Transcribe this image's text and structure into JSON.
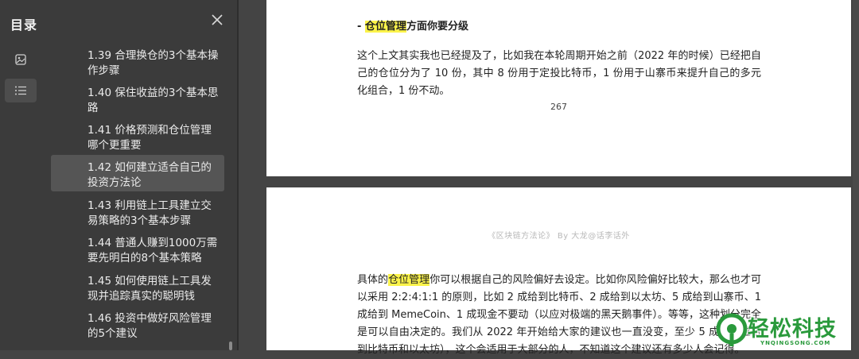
{
  "sidebar": {
    "title": "目录",
    "rail": {
      "thumbnail_icon": "image-icon",
      "outline_icon": "list-icon"
    },
    "toc": [
      {
        "label": "1.39 合理换仓的3个基本操作步骤",
        "active": false
      },
      {
        "label": "1.40 保住收益的3个基本思路",
        "active": false
      },
      {
        "label": "1.41 价格预测和仓位管理哪个更重要",
        "active": false
      },
      {
        "label": "1.42 如何建立适合自己的投资方法论",
        "active": true
      },
      {
        "label": "1.43 利用链上工具建立交易策略的3个基本步骤",
        "active": false
      },
      {
        "label": "1.44 普通人赚到1000万需要先明白的8个基本策略",
        "active": false
      },
      {
        "label": "1.45 如何使用链上工具发现并追踪真实的聪明钱",
        "active": false
      },
      {
        "label": "1.46 投资中做好风险管理的5个建议",
        "active": false
      }
    ]
  },
  "page1": {
    "heading_prefix": "- ",
    "heading_highlight": "仓位管理",
    "heading_rest": "方面你要分级",
    "paragraph": "这个上文其实我也已经提及了，比如我在本轮周期开始之前（2022 年的时候）已经把自己的仓位分为了 10 份，其中 8 份用于定投比特币，1 份用于山寨币来提升自己的多元化组合，1 份不动。",
    "page_number": "267"
  },
  "page2": {
    "running_header": "《区块链方法论》  By 大龙@话李话外",
    "para_prefix": "具体的",
    "para_highlight": "仓位管理",
    "para_rest": "你可以根据自己的风险偏好去设定。比如你风险偏好比较大，那么也才可以采用 2:2:4:1:1 的原则，比如 2 成给到比特币、2 成给到以太坊、5 成给到山寨币、1 成给到 MemeCoin、1 成现金不要动（以应对极端的黑天鹅事件）。等等，这种划分完全是可以自由决定的。我们从 2022 年开始给大家的建议也一直没变，至少 5 成的仓位给到比特币和以太坊），这个会适用于大部分的人，不知道这个建议还有多少人会记得。"
  },
  "watermark": {
    "main": "轻松科技",
    "sub": "YNQINGSONG.COM"
  },
  "colors": {
    "highlight": "#fbf34a",
    "sidebar_bg": "#3b3b3b",
    "viewer_bg": "#444444",
    "logo_green": "#2a9a3c"
  }
}
